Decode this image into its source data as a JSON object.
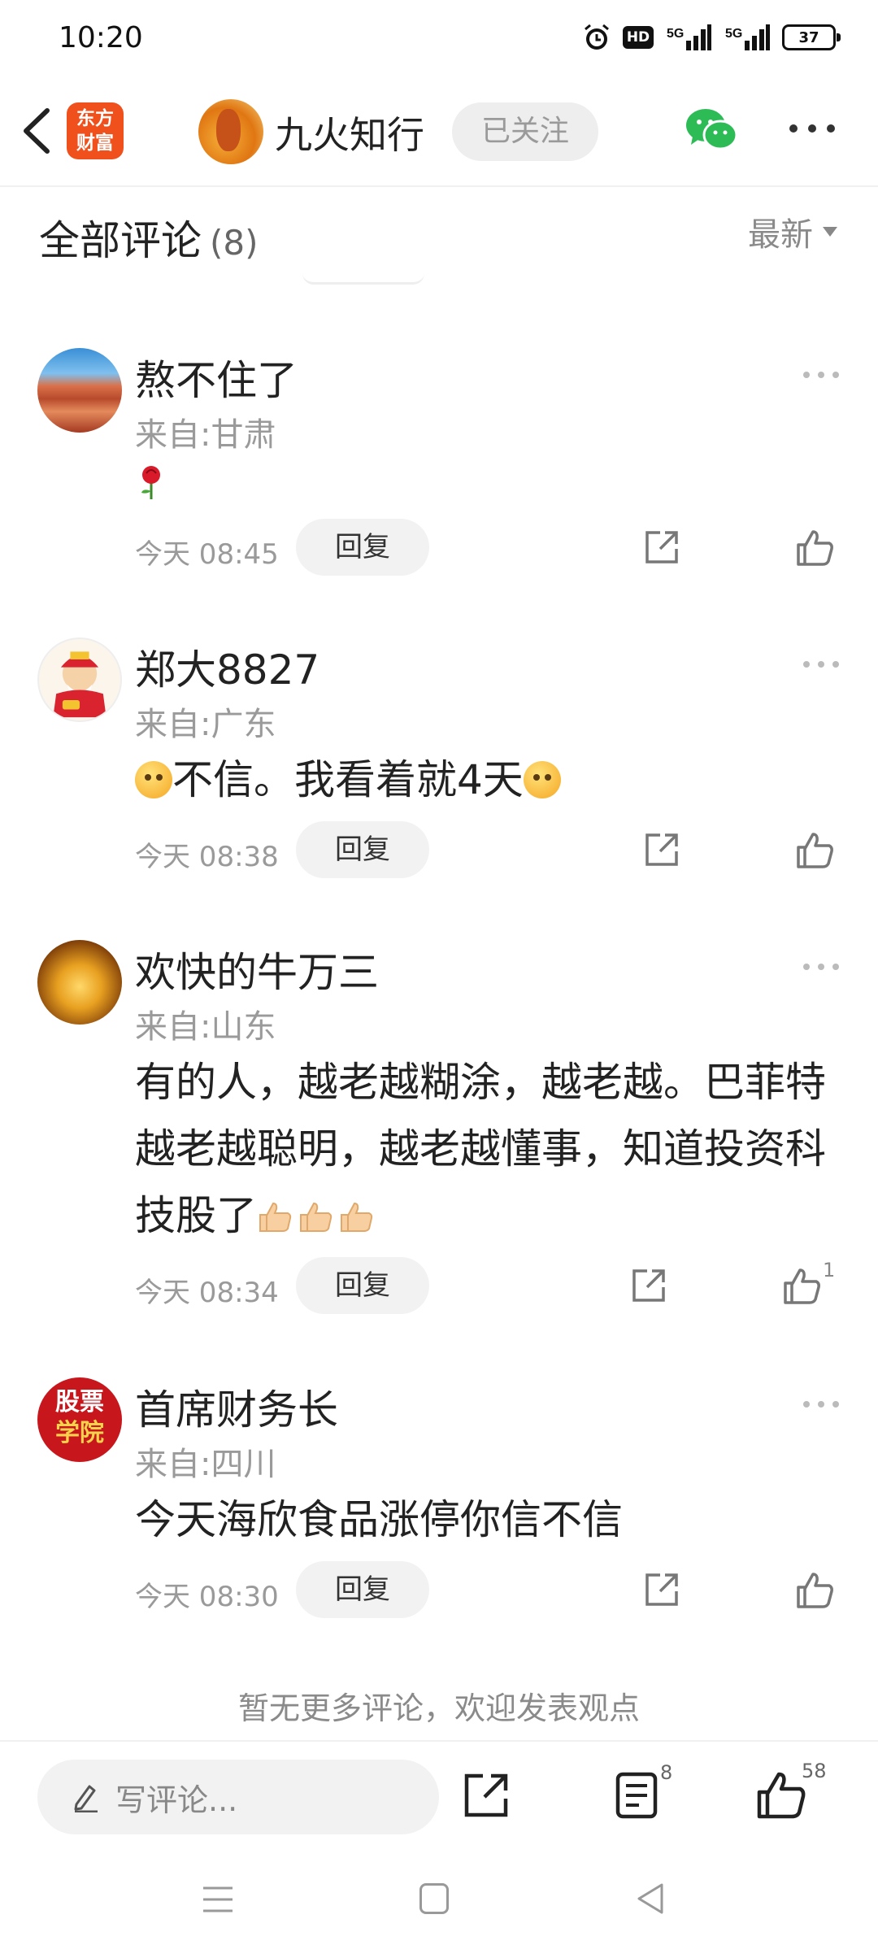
{
  "status_bar": {
    "time": "10:20",
    "hd_label": "HD",
    "signal1_label": "5G",
    "signal2_label": "5G",
    "battery": "37",
    "icons": [
      "alarm-icon",
      "hd-icon",
      "signal-5g-icon",
      "signal-5g-icon",
      "battery-icon"
    ]
  },
  "header": {
    "app_logo_line1": "东方",
    "app_logo_line2": "财富",
    "author_name": "九火知行",
    "follow_label": "已关注",
    "brand_color": "#f0501c",
    "wechat_color": "#2dbb56"
  },
  "comments_section": {
    "title": "全部评论",
    "count": "(8)",
    "sort_label": "最新",
    "items": [
      {
        "name": "熬不住了",
        "location": "来自:甘肃",
        "text_prefix": "",
        "text_main": "",
        "text_suffix": "",
        "emoji": "rose",
        "time": "今天 08:45",
        "reply_label": "回复",
        "likes": ""
      },
      {
        "name": "郑大8827",
        "location": "来自:广东",
        "text_main": "不信。我看着就4天",
        "time": "今天 08:38",
        "reply_label": "回复",
        "likes": ""
      },
      {
        "name": "欢快的牛万三",
        "location": "来自:山东",
        "text_main": "有的人，越老越糊涂，越老越。巴菲特越老越聪明，越老越懂事，知道投资科技股了",
        "time": "今天 08:34",
        "reply_label": "回复",
        "likes": "1"
      },
      {
        "name": "首席财务长",
        "location": "来自:四川",
        "text_main": "今天海欣食品涨停你信不信",
        "time": "今天 08:30",
        "reply_label": "回复",
        "likes": "",
        "avatar_line1": "股票",
        "avatar_line2": "学院"
      }
    ],
    "end_text": "暂无更多评论，欢迎发表观点"
  },
  "bottom_bar": {
    "write_placeholder": "写评论...",
    "comments_count": "8",
    "likes_count": "58"
  }
}
